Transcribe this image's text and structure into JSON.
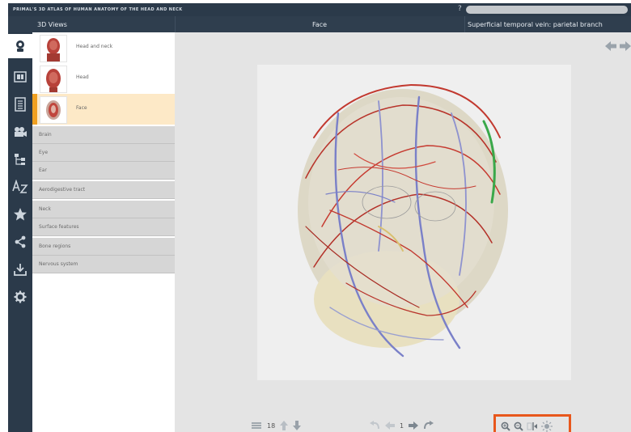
{
  "titlebar": {
    "title": "PRIMAL'S 3D ATLAS OF HUMAN ANATOMY OF THE HEAD AND NECK",
    "help_glyph": "?"
  },
  "header": {
    "views_label": "3D Views",
    "center_label": "Face",
    "structure_label": "Superficial temporal vein: parietal branch"
  },
  "views": [
    {
      "label": "Head and neck"
    },
    {
      "label": "Head"
    },
    {
      "label": "Face"
    }
  ],
  "sections": [
    "Brain",
    "Eye",
    "Ear",
    "Aerodigestive tract",
    "Neck",
    "Surface features",
    "Bone regions",
    "Nervous system"
  ],
  "bottom": {
    "layer_count": "18",
    "frame_number": "1"
  },
  "colors": {
    "accent": "#f0a020",
    "highlight_border": "#e8571c",
    "navbar": "#2b3a4a"
  }
}
